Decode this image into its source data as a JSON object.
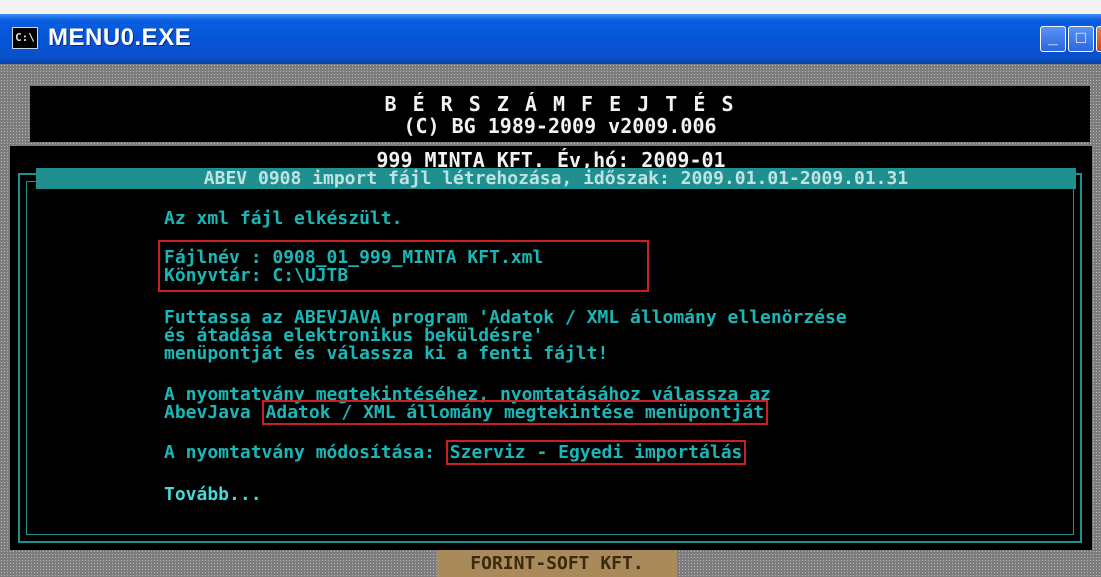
{
  "window": {
    "icon_text": "C:\\",
    "title": "MENU0.EXE",
    "min_symbol": "_",
    "max_symbol": "□",
    "close_symbol": "×"
  },
  "header": {
    "program_title": "B É R S Z Á M F E J T É S",
    "copyright": "(C) BG 1989-2009  v2009.006"
  },
  "main": {
    "company_line": "999  MINTA KFT.   Év,hó: 2009-01",
    "task_title": "ABEV 0908 import fájl létrehozása, időszak: 2009.01.01-2009.01.31",
    "status_message": "Az xml fájl elkészült.",
    "file_name_line": "Fájlnév : 0908_01_999_MINTA KFT.xml",
    "directory_line": "Könyvtár: C:\\UJTB",
    "instruction_lines": [
      "Futtassa az ABEVJAVA program 'Adatok / XML állomány ellenörzése",
      "és átadása elektronikus beküldésre'",
      "menüpontját és válassza ki a fenti fájlt!"
    ],
    "view_line_1": "A nyomtatvány megtekintéséhez, nyomtatásához válassza az",
    "view_line_2_prefix": "AbevJava ",
    "view_line_2_menu": "Adatok / XML állomány megtekintése menüpontját",
    "modify_prefix": "A nyomtatvány módosítása: ",
    "modify_menu": "Szerviz - Egyedi importálás",
    "continue_label": "Tovább..."
  },
  "footer": {
    "label": "FORINT-SOFT KFT."
  }
}
